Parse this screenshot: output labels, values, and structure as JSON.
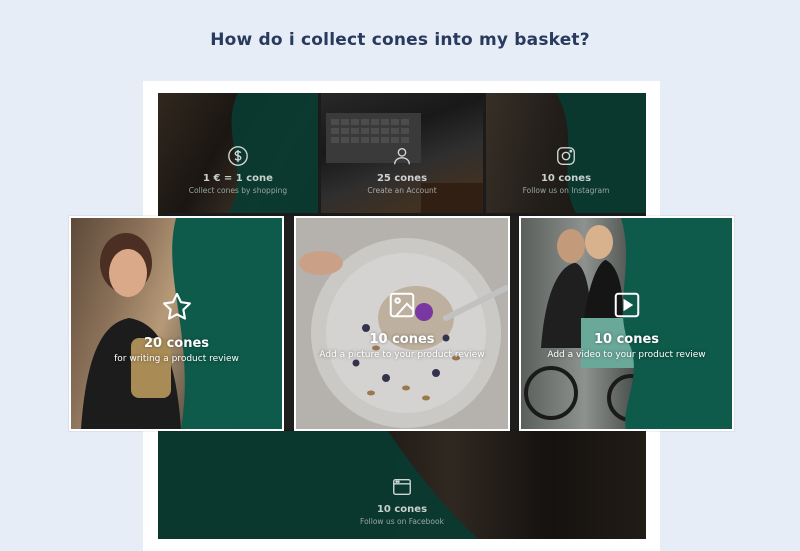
{
  "page": {
    "title": "How do i collect cones into my basket?"
  },
  "colors": {
    "background": "#e7edf7",
    "title": "#283a5e",
    "brand_green": "#0e5b4b",
    "brand_green_dark": "#0a3a30"
  },
  "tiles": [
    {
      "icon": "dollar-circle-icon",
      "amount": "1 € = 1 cone",
      "description": "Collect cones by shopping"
    },
    {
      "icon": "user-icon",
      "amount": "25 cones",
      "description": "Create an Account"
    },
    {
      "icon": "instagram-icon",
      "amount": "10 cones",
      "description": "Follow us on Instagram"
    },
    {
      "icon": "facebook-window-icon",
      "amount": "10 cones",
      "description": "Follow us on Facebook"
    }
  ],
  "cards": [
    {
      "icon": "star-icon",
      "amount": "20 cones",
      "description": "for writing a product review"
    },
    {
      "icon": "image-icon",
      "amount": "10 cones",
      "description": "Add a picture to your product review"
    },
    {
      "icon": "play-icon",
      "amount": "10 cones",
      "description": "Add a video to your product review"
    }
  ]
}
